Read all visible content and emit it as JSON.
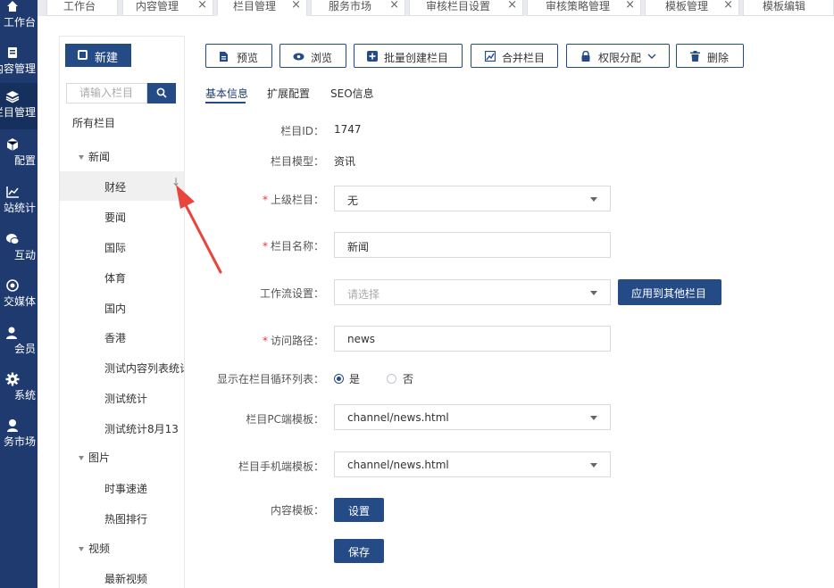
{
  "sidebar": {
    "items": [
      {
        "label": "工作台",
        "icon": "home-icon"
      },
      {
        "label": "内容管理",
        "icon": "document-icon"
      },
      {
        "label": "栏目管理",
        "icon": "layers-icon",
        "active": true
      },
      {
        "label": "配置",
        "icon": "cube-icon"
      },
      {
        "label": "站统计",
        "icon": "chart-line-icon"
      },
      {
        "label": "互动",
        "icon": "chat-icon"
      },
      {
        "label": "交媒体",
        "icon": "target-icon"
      },
      {
        "label": "会员",
        "icon": "user-icon"
      },
      {
        "label": "系统",
        "icon": "gear-icon"
      },
      {
        "label": "务市场",
        "icon": "person-icon"
      }
    ]
  },
  "tabs": [
    {
      "label": "工作台"
    },
    {
      "label": "内容管理"
    },
    {
      "label": "栏目管理",
      "active": true
    },
    {
      "label": "服务市场"
    },
    {
      "label": "审核栏目设置"
    },
    {
      "label": "审核策略管理"
    },
    {
      "label": "模板管理"
    },
    {
      "label": "模板编辑"
    }
  ],
  "tabs_close": "×",
  "tree": {
    "new_label": "新建",
    "search_placeholder": "请输入栏目",
    "all_label": "所有栏目",
    "groups": [
      {
        "label": "新闻",
        "children": [
          "财经",
          "要闻",
          "国际",
          "体育",
          "国内",
          "香港",
          "测试内容列表统计",
          "测试统计",
          "测试统计8月13"
        ]
      },
      {
        "label": "图片",
        "children": [
          "时事速递",
          "热图排行"
        ]
      },
      {
        "label": "视频",
        "children": [
          "最新视频"
        ]
      }
    ],
    "selected": "财经",
    "move_down_glyph": "↓"
  },
  "toolbar": {
    "preview": "预览",
    "browse": "浏览",
    "batch_create": "批量创建栏目",
    "merge": "合并栏目",
    "permissions": "权限分配",
    "delete": "删除"
  },
  "form_tabs": [
    "基本信息",
    "扩展配置",
    "SEO信息"
  ],
  "form": {
    "id_label": "栏目ID：",
    "id_value": "1747",
    "model_label": "栏目模型：",
    "model_value": "资讯",
    "parent_label": "上级栏目：",
    "parent_value": "无",
    "name_label": "栏目名称：",
    "name_value": "新闻",
    "workflow_label": "工作流设置：",
    "workflow_placeholder": "请选择",
    "apply_other": "应用到其他栏目",
    "path_label": "访问路径：",
    "path_value": "news",
    "show_label": "显示在栏目循环列表：",
    "show_yes": "是",
    "show_no": "否",
    "show_selected": "是",
    "pc_tpl_label": "栏目PC端模板：",
    "pc_tpl_value": "channel/news.html",
    "mobile_tpl_label": "栏目手机端模板：",
    "mobile_tpl_value": "channel/news.html",
    "content_tpl_label": "内容模板：",
    "set_button": "设置",
    "save_button": "保存",
    "required_mark": "*"
  },
  "colors": {
    "nav_bg": "#1e3a6e",
    "primary": "#254b87",
    "required": "#e4393c",
    "annotation": "#e8453c"
  }
}
